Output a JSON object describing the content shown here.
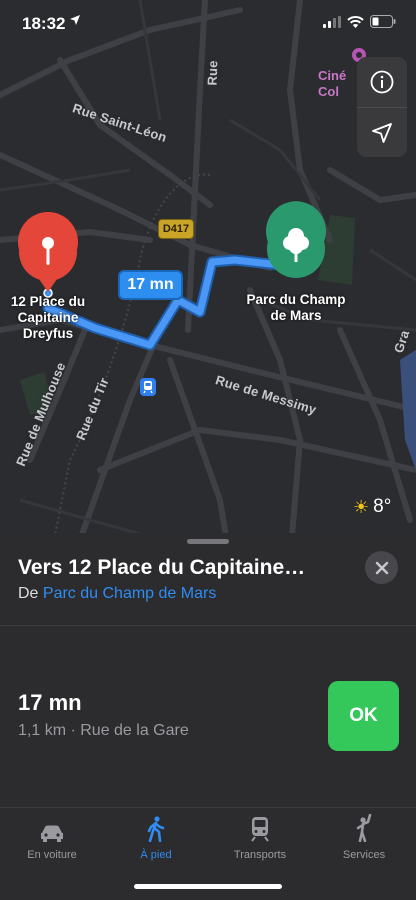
{
  "status_bar": {
    "time": "18:32"
  },
  "map": {
    "streets": {
      "rue_saint_leon": "Rue Saint-Léon",
      "rue_de_mulhouse": "Rue de Mulhouse",
      "rue_du_tir": "Rue du Tir",
      "rue_de_messimy": "Rue de Messimy",
      "rue_top": "Rue",
      "grand_right": "Gra"
    },
    "poi_cinema": [
      "Ciné",
      "Col"
    ],
    "road_badge": "D417",
    "route_time": "17 mn",
    "origin_label": [
      "12 Place du",
      "Capitaine",
      "Dreyfus"
    ],
    "destination_label": [
      "Parc du Champ",
      "de Mars"
    ],
    "weather_temp": "8°",
    "colors": {
      "route": "#3f8ff2",
      "origin_pin": "#e5463a",
      "destination_pin": "#2a9a6e"
    }
  },
  "sheet": {
    "title": "Vers 12 Place du Capitaine…",
    "from_prefix": "De",
    "from_place": "Parc du Champ de Mars",
    "duration": "17 mn",
    "meta": "1,1 km · Rue de la Gare",
    "ok_label": "OK"
  },
  "tabs": [
    {
      "label": "En voiture",
      "icon": "car-icon"
    },
    {
      "label": "À pied",
      "icon": "walking-icon"
    },
    {
      "label": "Transports",
      "icon": "train-icon"
    },
    {
      "label": "Services",
      "icon": "hail-icon"
    }
  ]
}
